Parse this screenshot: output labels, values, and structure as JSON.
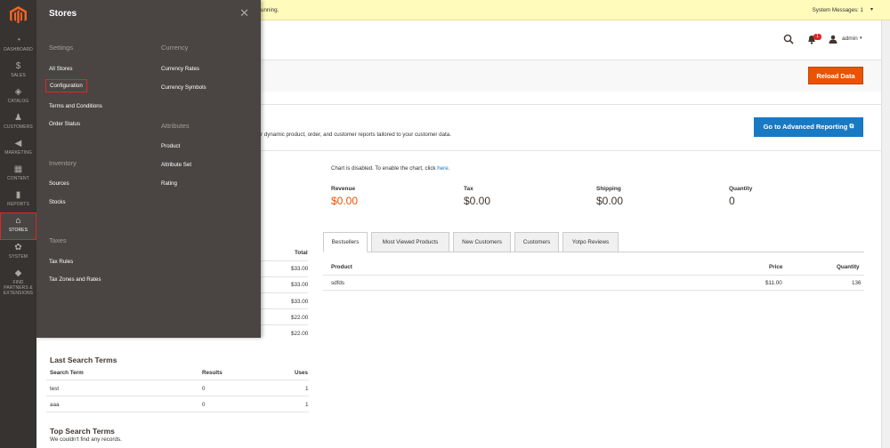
{
  "notice": {
    "message": "unning.",
    "system_messages": "System Messages: 1"
  },
  "header": {
    "badge_count": "1",
    "user": "admin"
  },
  "buttons": {
    "reload": "Reload Data",
    "advanced": "Go to Advanced Reporting"
  },
  "advanced_text": "r dynamic product, order, and customer reports tailored to your customer data.",
  "chart": {
    "msg": "Chart is disabled. To enable the chart, click",
    "link": "here."
  },
  "stats": [
    {
      "label": "Revenue",
      "value": "$0.00"
    },
    {
      "label": "Tax",
      "value": "$0.00"
    },
    {
      "label": "Shipping",
      "value": "$0.00"
    },
    {
      "label": "Quantity",
      "value": "0"
    }
  ],
  "rail": [
    {
      "label": "DASHBOARD",
      "icon": "dashboard-icon"
    },
    {
      "label": "SALES",
      "icon": "dollar-icon"
    },
    {
      "label": "CATALOG",
      "icon": "box-icon"
    },
    {
      "label": "CUSTOMERS",
      "icon": "user-icon"
    },
    {
      "label": "MARKETING",
      "icon": "megaphone-icon"
    },
    {
      "label": "CONTENT",
      "icon": "content-icon"
    },
    {
      "label": "REPORTS",
      "icon": "bar-chart-icon"
    },
    {
      "label": "STORES",
      "icon": "store-icon"
    },
    {
      "label": "SYSTEM",
      "icon": "gear-icon"
    },
    {
      "label": "FIND PARTNERS & EXTENSIONS",
      "icon": "puzzle-icon"
    }
  ],
  "flyout": {
    "title": "Stores",
    "settings": {
      "heading": "Settings",
      "items": [
        "All Stores",
        "Configuration",
        "Terms and Conditions",
        "Order Status"
      ]
    },
    "inventory": {
      "heading": "Inventory",
      "items": [
        "Sources",
        "Stocks"
      ]
    },
    "taxes": {
      "heading": "Taxes",
      "items": [
        "Tax Rules",
        "Tax Zones and Rates"
      ]
    },
    "currency": {
      "heading": "Currency",
      "items": [
        "Currency Rates",
        "Currency Symbols"
      ]
    },
    "attributes": {
      "heading": "Attributes",
      "items": [
        "Product",
        "Attribute Set",
        "Rating"
      ]
    }
  },
  "orders_table": {
    "total_header": "Total",
    "totals": [
      "$33.00",
      "$33.00",
      "$33.00",
      "$22.00",
      "$22.00"
    ]
  },
  "tabs": [
    "Bestsellers",
    "Most Viewed Products",
    "New Customers",
    "Customers",
    "Yotpo Reviews"
  ],
  "bestsellers": {
    "headers": [
      "Product",
      "Price",
      "Quantity"
    ],
    "row": [
      "sdfds",
      "$11.00",
      "136"
    ]
  },
  "last_search": {
    "title": "Last Search Terms",
    "headers": [
      "Search Term",
      "Results",
      "Uses"
    ],
    "rows": [
      [
        "test",
        "0",
        "1"
      ],
      [
        "aaa",
        "0",
        "1"
      ]
    ]
  },
  "top_search": {
    "title": "Top Search Terms",
    "empty": "We couldn't find any records."
  }
}
